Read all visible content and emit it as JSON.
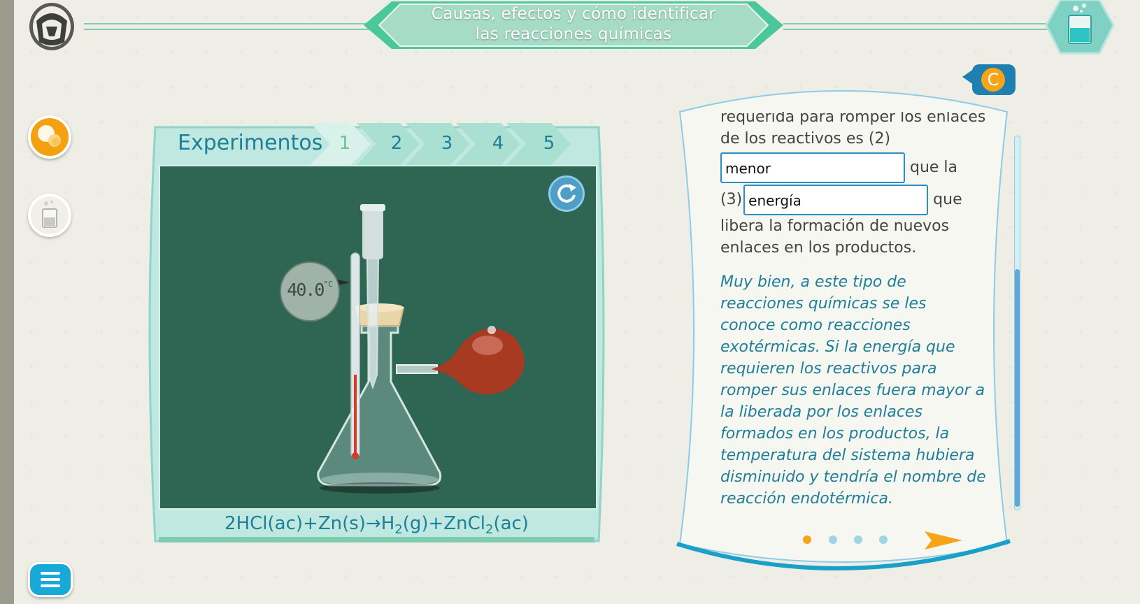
{
  "header": {
    "title_line1": "Causas, efectos y cómo identificar",
    "title_line2": "las reacciones químicas"
  },
  "experiments": {
    "label": "Experimentos",
    "tabs": [
      "1",
      "2",
      "3",
      "4",
      "5"
    ],
    "active_tab": "1",
    "temperature_reading": "40.0",
    "temperature_unit": "°C"
  },
  "equation": {
    "part1": "2HCl(ac)+Zn(s)→H",
    "sub1": "2",
    "part2": "(g)+ZnCl",
    "sub2": "2",
    "part3": "(ac)"
  },
  "text_panel": {
    "badge_letter": "C",
    "line_top": "requerida para romper los enlaces",
    "line2": "de los reactivos es (2)",
    "answer_2": "menor",
    "after_answer_2": "que la",
    "prefix_3": "(3)",
    "answer_3": "energía",
    "after_answer_3": "que",
    "line_rest": "libera la formación de nuevos enlaces en los productos.",
    "feedback": "Muy bien, a este tipo de reacciones químicas se les conoce como reacciones exotérmicas. Si la energía que requieren los reactivos para romper sus enlaces fuera mayor a la liberada por los enlaces formados en los productos, la temperatura del sistema hubiera disminuido y tendría el nombre de reacción endotérmica."
  },
  "pagination": {
    "total_pages": 4,
    "current_page": 1
  },
  "colors": {
    "accent_teal": "#1f7e99",
    "mint": "#7fcdb0",
    "stage_green": "#2f6553",
    "orange": "#f3a10f",
    "balloon": "#a93a22"
  }
}
